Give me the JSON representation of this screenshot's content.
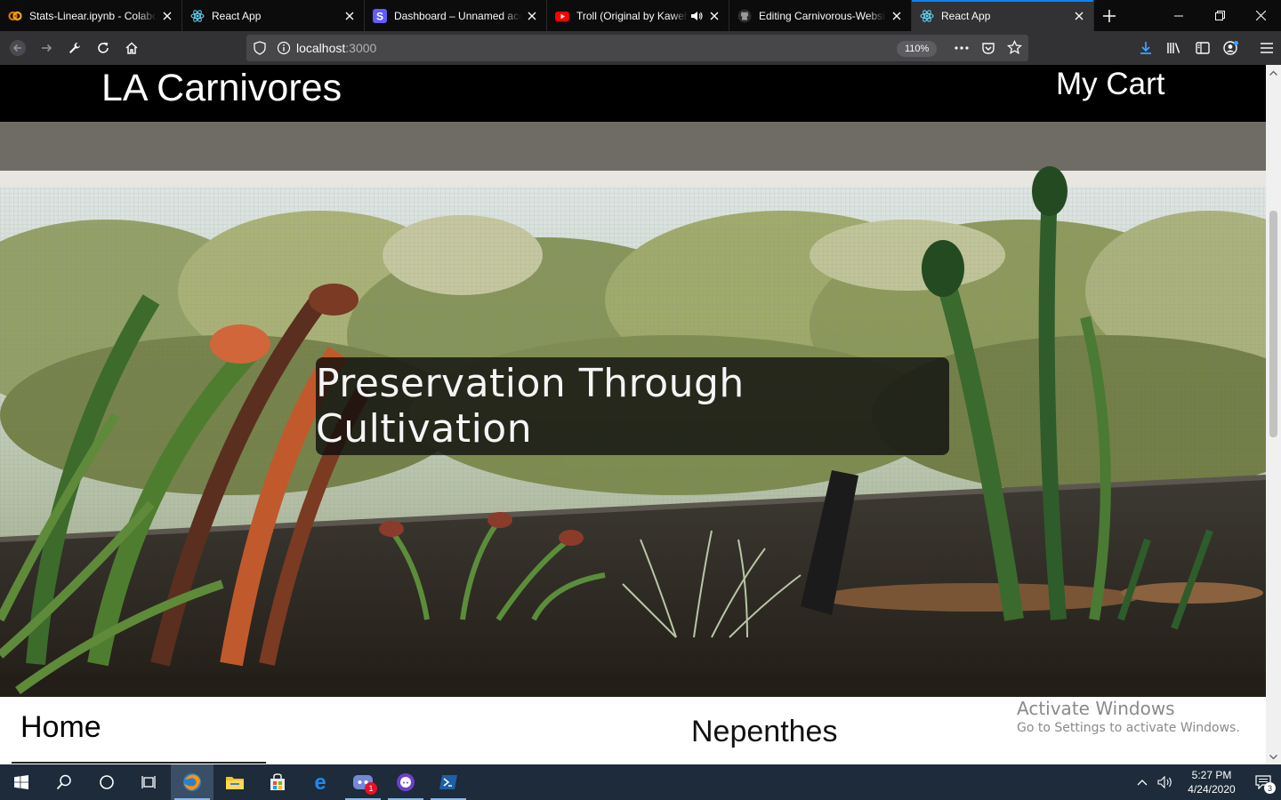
{
  "browser": {
    "tabs": [
      {
        "title": "Stats-Linear.ipynb - Colaboratory",
        "favicon": "colab-icon",
        "active": false
      },
      {
        "title": "React App",
        "favicon": "react-icon",
        "active": false
      },
      {
        "title": "Dashboard – Unnamed account",
        "favicon": "stripe-icon",
        "active": false
      },
      {
        "title": "Troll (Original by Kawehi)",
        "favicon": "youtube-icon",
        "active": false,
        "playing_audio": true
      },
      {
        "title": "Editing Carnivorous-Website",
        "favicon": "github-icon",
        "active": false
      },
      {
        "title": "React App",
        "favicon": "react-icon",
        "active": true
      }
    ],
    "url_host": "localhost",
    "url_port": ":3000",
    "zoom": "110%",
    "accent_color": "#0a84ff"
  },
  "site": {
    "brand": "LA Carnivores",
    "cart_label": "My Cart",
    "tagline": "Preservation Through Cultivation",
    "home_heading": "Home",
    "section_heading": "Nepenthes"
  },
  "watermark": {
    "line1": "Activate Windows",
    "line2": "Go to Settings to activate Windows."
  },
  "taskbar": {
    "time": "5:27 PM",
    "date": "4/24/2020",
    "notification_count": "3",
    "discord_badge": "1"
  }
}
